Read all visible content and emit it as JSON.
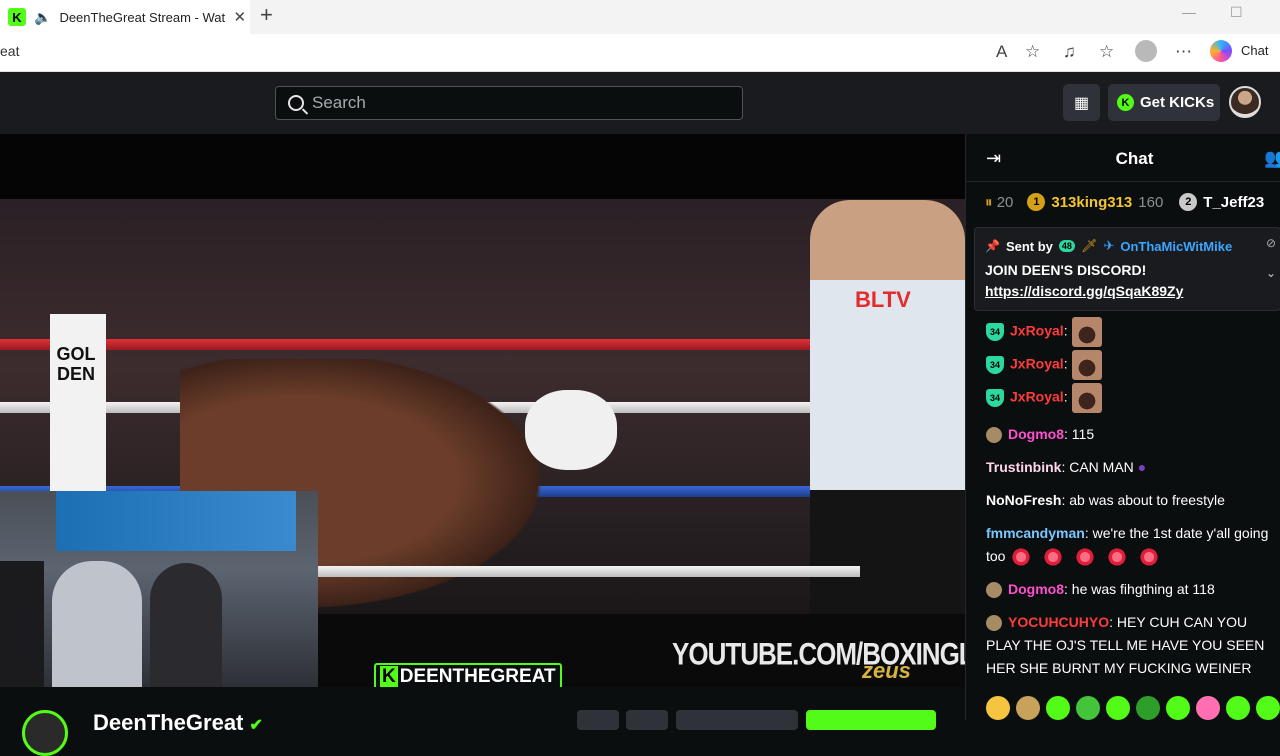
{
  "browser": {
    "tab_title": "DeenTheGreat Stream - Watch",
    "favicon_letter": "K",
    "address": "eat",
    "chat_label": "Chat"
  },
  "header": {
    "search_placeholder": "Search",
    "get_kicks_label": "Get KICKs",
    "accent": "#53fc18"
  },
  "video": {
    "overlay_tag_k": "K",
    "overlay_tag": "DEENTHEGREAT",
    "watermark": "YOUTUBE.COM/BOXINGLEGENDSTV",
    "zeus": "zeus",
    "bltv": "BLTV",
    "post_text": "GOLDEN"
  },
  "channel": {
    "name": "DeenTheGreat"
  },
  "chat": {
    "title": "Chat",
    "leaderboard": {
      "gifts": "20",
      "rank1": "1",
      "user1": "313king313",
      "count1": "160",
      "rank2": "2",
      "user2": "T_Jeff23"
    },
    "pinned": {
      "sent_by": "Sent by",
      "badge": "48",
      "user": "OnThaMicWitMike",
      "line1": "JOIN DEEN'S DISCORD!",
      "link": "https://discord.gg/qSqaK89Zy"
    },
    "messages": [
      {
        "badge": "34",
        "user": "JxRoyal",
        "color": "#ff3b3b",
        "text": ""
      },
      {
        "badge": "34",
        "user": "JxRoyal",
        "color": "#ff3b3b",
        "text": ""
      },
      {
        "badge": "34",
        "user": "JxRoyal",
        "color": "#ff3b3b",
        "text": ""
      },
      {
        "user": "Dogmo8",
        "color": "#ff4fcf",
        "text": "115"
      },
      {
        "user": "Trustinbink",
        "color": "#ffd6ec",
        "text": "CAN MAN"
      },
      {
        "user": "NoNoFresh",
        "color": "#ffffff",
        "text": "ab was about to freestyle"
      },
      {
        "user": "fmmcandyman",
        "color": "#7ac7ff",
        "text": "we're the 1st date y'all going too"
      },
      {
        "user": "Dogmo8",
        "color": "#ff4fcf",
        "text": "he was fihgthing at 118"
      },
      {
        "user": "YOCUHCUHYO",
        "color": "#ff3b3b",
        "text": "HEY CUH CAN YOU PLAY THE OJ'S TELL ME HAVE YOU SEEN HER SHE BURNT MY FUCKING WEINER"
      }
    ]
  }
}
